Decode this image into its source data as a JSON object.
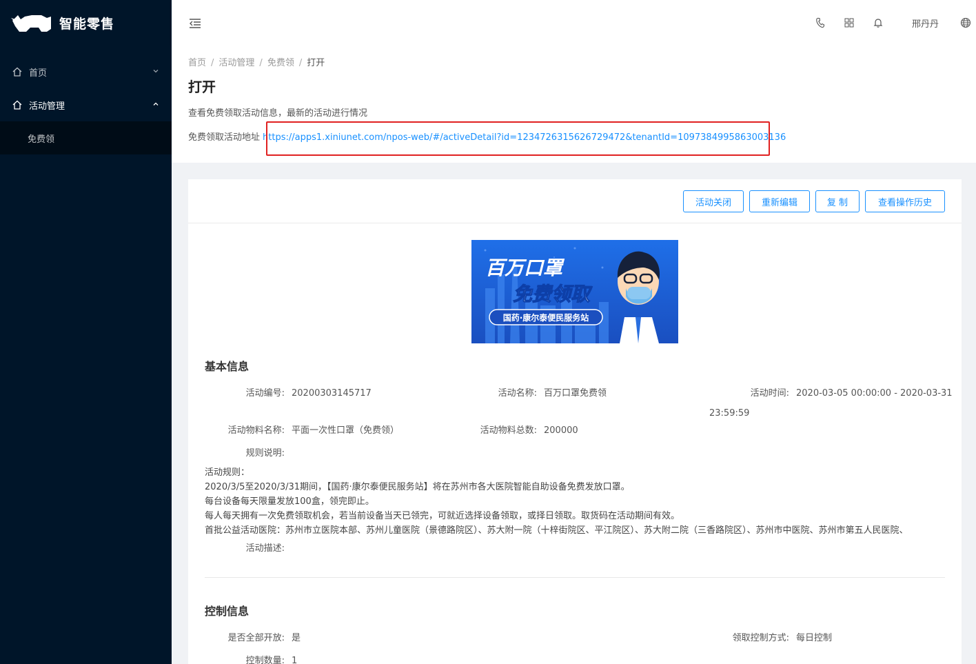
{
  "sidebar": {
    "brand": "智能零售",
    "menu": [
      {
        "label": "首页",
        "arrow": "⌄"
      },
      {
        "label": "活动管理",
        "arrow": "⌃"
      }
    ],
    "submenu": [
      {
        "label": "免费领"
      }
    ]
  },
  "header": {
    "user": "邢丹丹",
    "icons": [
      "phone-icon",
      "qrcode-icon",
      "bell-icon",
      "globe-icon"
    ]
  },
  "breadcrumb": [
    "首页",
    "活动管理",
    "免费领",
    "打开"
  ],
  "page": {
    "title": "打开",
    "description": "查看免费领取活动信息，最新的活动进行情况",
    "address_label": "免费领取活动地址",
    "address_url": "https://apps1.xiniunet.com/npos-web/#/activeDetail?id=1234726315626729472&tenantId=1097384995863003136"
  },
  "toolbar": {
    "close_label": "活动关闭",
    "reedit_label": "重新编辑",
    "copy_label": "复 制",
    "history_label": "查看操作历史"
  },
  "banner": {
    "line1": "百万口罩",
    "line2": "免费领取",
    "tag": "国药·康尔泰便民服务站"
  },
  "basic_info": {
    "title": "基本信息",
    "code_label": "活动编号:",
    "code_value": "20200303145717",
    "name_label": "活动名称:",
    "name_value": "百万口罩免费领",
    "time_label": "活动时间:",
    "time_value_1": "2020-03-05 00:00:00 - 2020-03-31",
    "time_value_2": "23:59:59",
    "material_label": "活动物料名称:",
    "material_value": "平面一次性口罩（免费领）",
    "total_label": "活动物料总数:",
    "total_value": "200000",
    "rules_label": "规则说明:",
    "rules": [
      "活动规则：",
      "2020/3/5至2020/3/31期间，【国药·康尔泰便民服务站】将在苏州市各大医院智能自助设备免费发放口罩。",
      "每台设备每天限量发放100盒，领完即止。",
      "每人每天拥有一次免费领取机会，若当前设备当天已领完，可就近选择设备领取，或择日领取。取货码在活动期间有效。",
      "首批公益活动医院：苏州市立医院本部、苏州儿童医院（景德路院区）、苏大附一院（十梓街院区、平江院区）、苏大附二院（三香路院区）、苏州市中医院、苏州市第五人民医院、"
    ],
    "desc_label": "活动描述:"
  },
  "control_info": {
    "title": "控制信息",
    "open_label": "是否全部开放:",
    "open_value": "是",
    "mode_label": "领取控制方式:",
    "mode_value": "每日控制",
    "qty_label": "控制数量:",
    "qty_value": "1"
  },
  "colors": {
    "sidebar_bg": "#001529",
    "accent": "#1890ff",
    "highlight_box": "#e02020"
  }
}
